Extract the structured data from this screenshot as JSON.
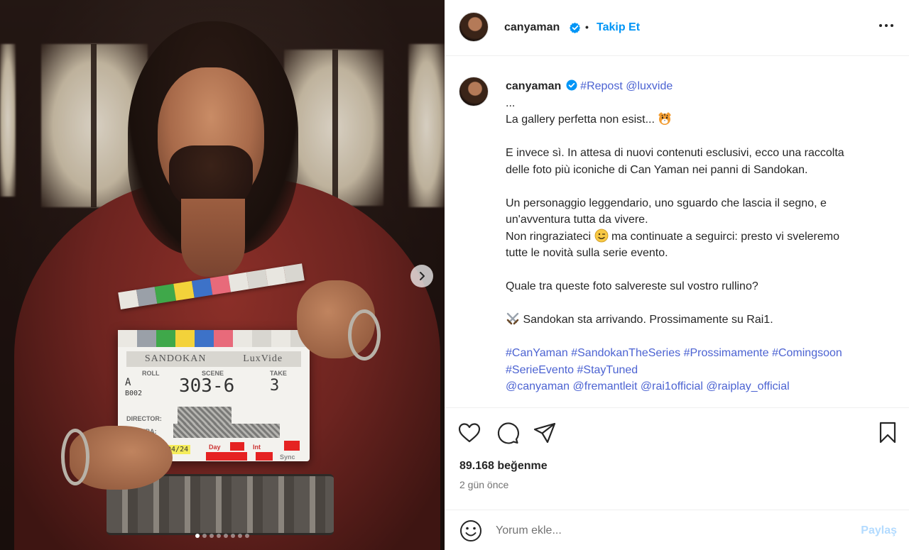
{
  "post": {
    "username": "canyaman",
    "separator": "•",
    "follow_label": "Takip Et",
    "more_icon": "more-horizontal-icon"
  },
  "caption": {
    "username": "canyaman",
    "repost_tag": "#Repost",
    "repost_handle": "@luxvide",
    "line_dots": "...",
    "line_1": "La gallery perfetta non esist...",
    "line_2a": "E invece sì. In attesa di nuovi contenuti esclusivi, ecco una raccolta",
    "line_2b": "delle foto più iconiche di Can Yaman nei panni di Sandokan.",
    "line_3a": "Un personaggio leggendario, uno sguardo che lascia il segno, e",
    "line_3b": "un'avventura tutta da vivere.",
    "line_4a_pre": "Non ringraziateci",
    "line_4a_post": "ma continuate a seguirci: presto vi sveleremo",
    "line_4b": "tutte le novità sulla serie evento.",
    "line_5": "Quale tra queste foto salvereste sul vostro rullino?",
    "line_6": "Sandokan sta arrivando. Prossimamente su Rai1.",
    "hashtags_1": [
      "#CanYaman",
      "#SandokanTheSeries",
      "#Prossimamente",
      "#Comingsoon"
    ],
    "hashtags_2": [
      "#SerieEvento",
      "#StayTuned"
    ],
    "mentions": [
      "@canyaman",
      "@fremantleit",
      "@rai1official",
      "@raiplay_official"
    ]
  },
  "engagement": {
    "likes": "89.168 beğenme",
    "date": "2 gün önce"
  },
  "comment": {
    "placeholder": "Yorum ekle...",
    "share_label": "Paylaş"
  },
  "media": {
    "slate_title_left": "SANDOKAN",
    "slate_title_right": "LuxVide",
    "slate_roll": "ROLL",
    "slate_scene": "SCENE",
    "slate_take": "TAKE",
    "slate_scene_value": "303-6",
    "slate_take_value": "3",
    "slate_roll_value": "A",
    "slate_roll_value2": "B002",
    "slate_director": "DIRECTOR:",
    "slate_camera": "CAMERA:",
    "slate_day": "Day",
    "slate_int": "Int",
    "slate_sync": "Sync",
    "slate_date": "/04/24",
    "carousel_dots": 8,
    "carousel_active_index": 0
  },
  "colors": {
    "link": "#4c63d2",
    "follow": "#0095f6",
    "verified": "#0095f6",
    "share_disabled": "#b3dbff"
  }
}
